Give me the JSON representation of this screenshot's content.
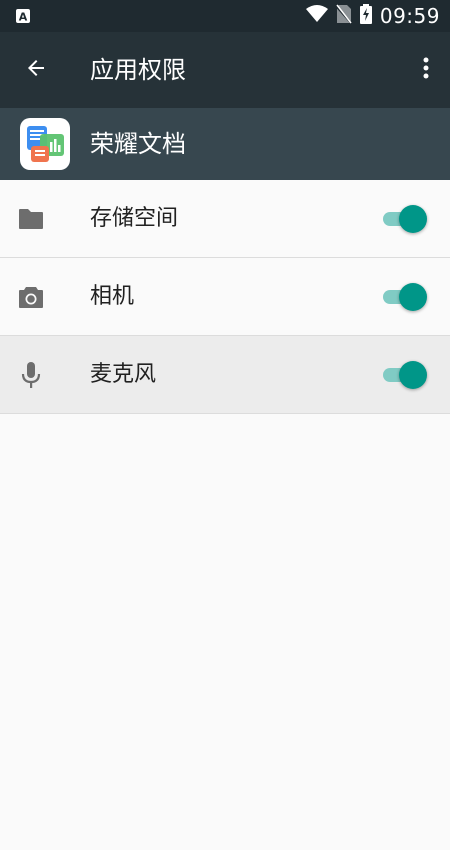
{
  "status_bar": {
    "time": "09:59",
    "icons": [
      "accessibility-a-icon",
      "wifi-icon",
      "no-sim-icon",
      "battery-charging-icon"
    ]
  },
  "app_bar": {
    "title": "应用权限",
    "back_icon": "back-arrow-icon",
    "more_icon": "more-vert-icon"
  },
  "app": {
    "name": "荣耀文档",
    "icon": "honor-docs-app-icon"
  },
  "permissions": [
    {
      "label": "存储空间",
      "icon": "folder-icon",
      "enabled": true
    },
    {
      "label": "相机",
      "icon": "camera-icon",
      "enabled": true
    },
    {
      "label": "麦克风",
      "icon": "microphone-icon",
      "enabled": true
    }
  ],
  "colors": {
    "status_bar": "#1f2a30",
    "app_bar": "#263238",
    "app_header": "#37474f",
    "switch_on_thumb": "#009688",
    "switch_on_track": "#80cbc4",
    "background": "#fafafa"
  }
}
